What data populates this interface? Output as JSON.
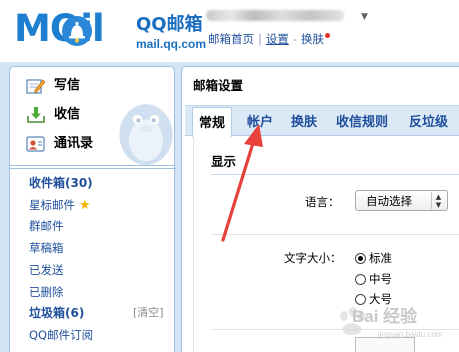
{
  "header": {
    "logo_word": "MOil",
    "logo_cn": "QQ邮箱",
    "logo_url": "mail.qq.com",
    "user_caret": "▼",
    "links": [
      {
        "label": "邮箱首页"
      },
      {
        "label": "设置"
      },
      {
        "label": "换肤"
      }
    ],
    "link_separator": "|",
    "notification_color": "#e0302a"
  },
  "sidebar": {
    "compose": [
      {
        "label": "写信",
        "icon": "compose-icon"
      },
      {
        "label": "收信",
        "icon": "inbox-download-icon"
      },
      {
        "label": "通讯录",
        "icon": "contacts-icon"
      }
    ],
    "folders": [
      {
        "label": "收件箱(30)",
        "bold": true
      },
      {
        "label": "星标邮件",
        "star": "★"
      },
      {
        "label": "群邮件"
      },
      {
        "label": "草稿箱"
      },
      {
        "label": "已发送"
      },
      {
        "label": "已删除"
      },
      {
        "label": "垃圾箱(6)",
        "bold": true
      },
      {
        "label": "QQ邮件订阅"
      }
    ],
    "clear_label": "[清空]"
  },
  "main": {
    "title": "邮箱设置",
    "tabs": [
      {
        "label": "常规",
        "active": true
      },
      {
        "label": "帐户"
      },
      {
        "label": "换肤"
      },
      {
        "label": "收信规则"
      },
      {
        "label": "反垃级"
      }
    ],
    "section_title": "显示",
    "language": {
      "label": "语言：",
      "value": "自动选择",
      "arrows": "▲▼"
    },
    "font_size": {
      "label": "文字大小：",
      "options": [
        {
          "label": "标准",
          "selected": true
        },
        {
          "label": "中号",
          "selected": false
        },
        {
          "label": "大号",
          "selected": false
        }
      ]
    }
  },
  "watermark": {
    "text": "Bai 经验",
    "sub": "jingyan.baidu.com"
  },
  "colors": {
    "brand_blue": "#1e7fd0",
    "link_blue": "#1f4f9c",
    "frame_blue": "#d4e6f6",
    "arrow_red": "#e8403a",
    "star_yellow": "#f5b400"
  }
}
